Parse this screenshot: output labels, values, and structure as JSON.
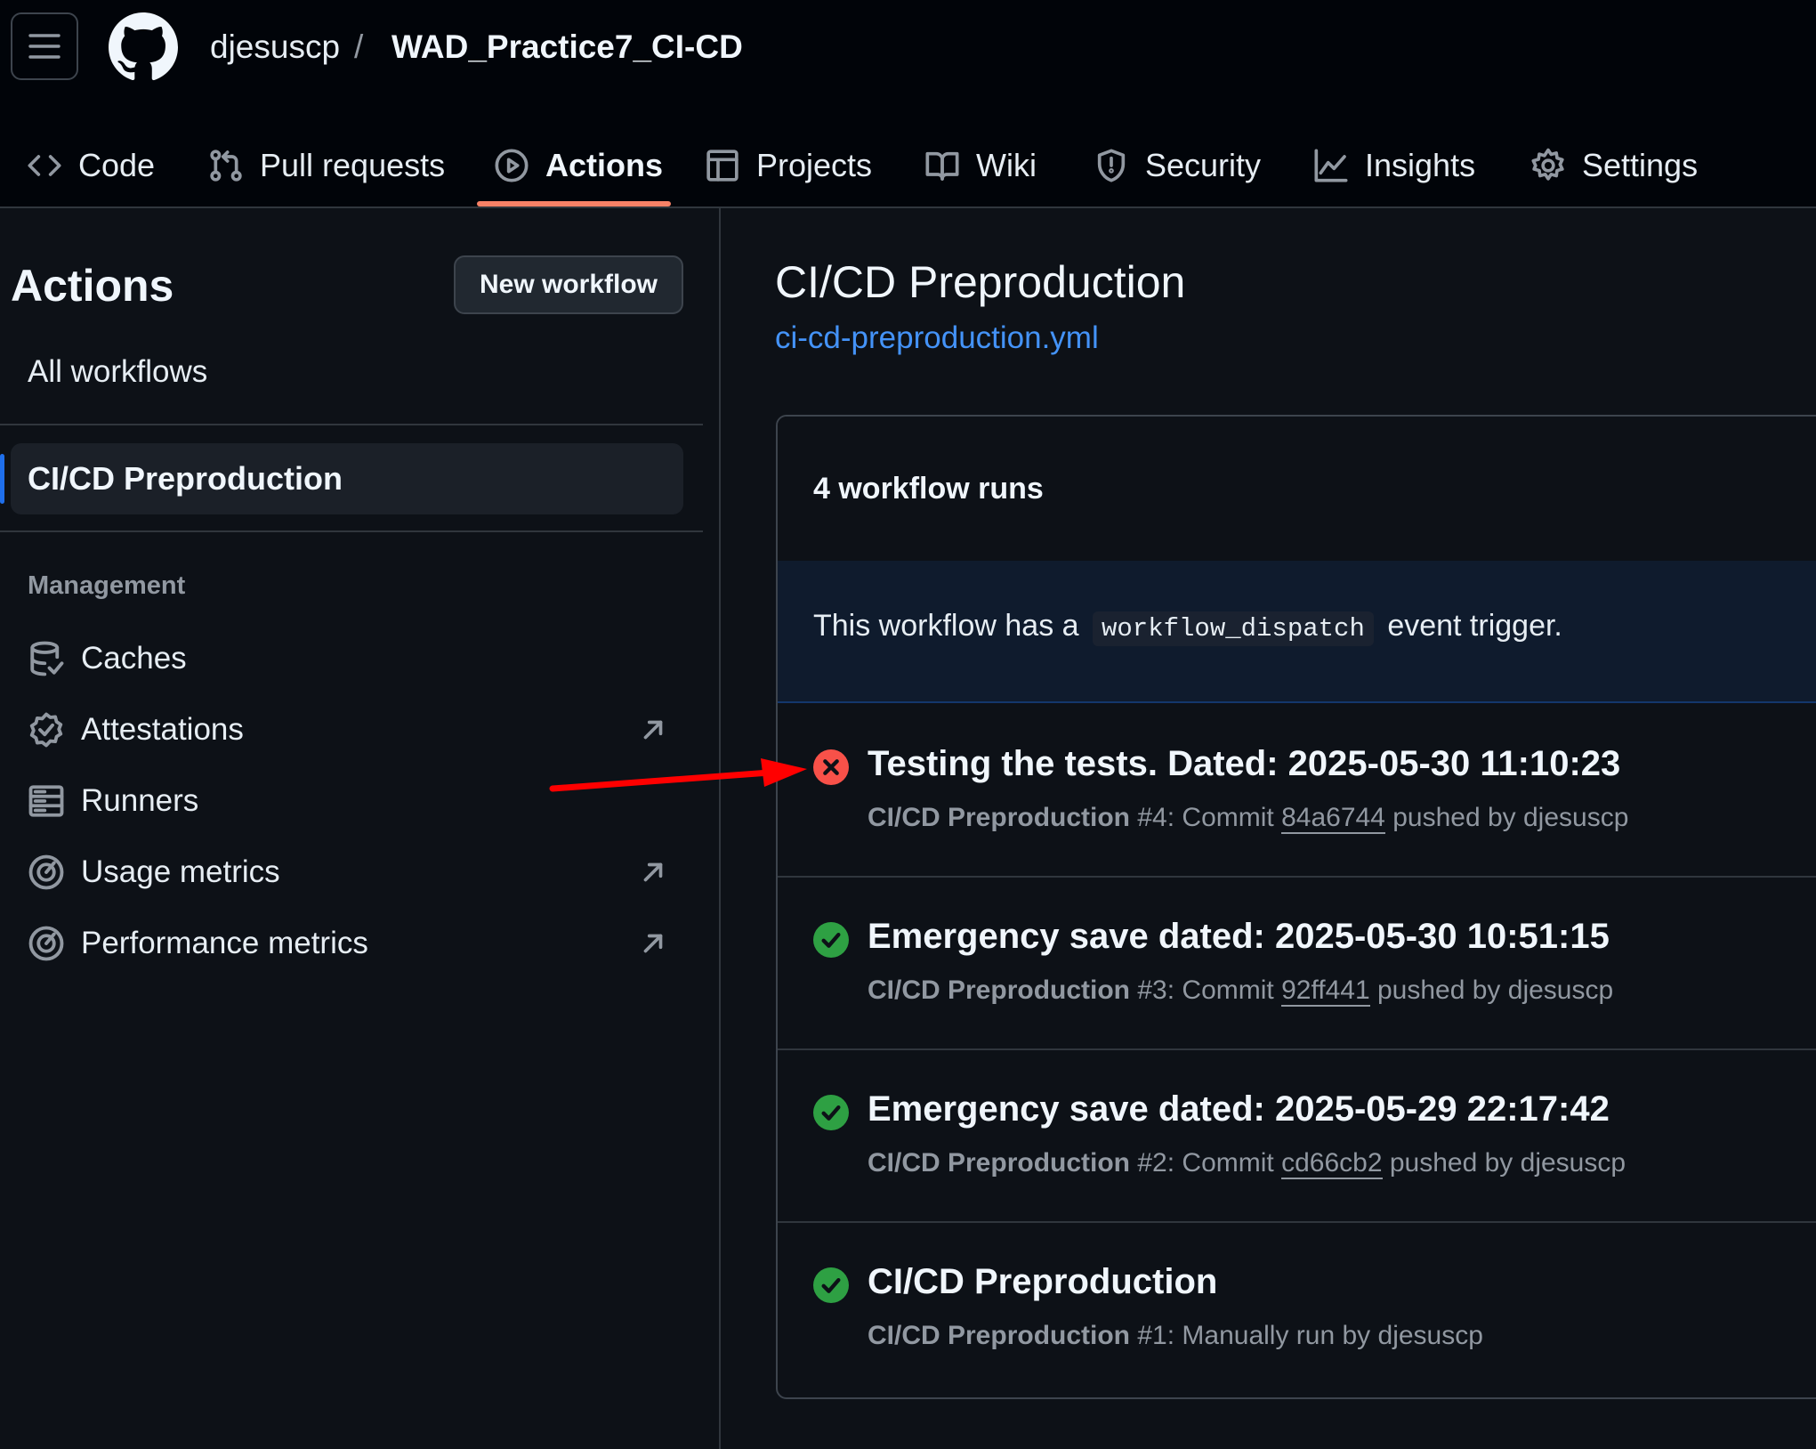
{
  "header": {
    "owner": "djesuscp",
    "separator": "/",
    "repo": "WAD_Practice7_CI-CD"
  },
  "tabs": [
    {
      "label": "Code",
      "icon": "code-icon"
    },
    {
      "label": "Pull requests",
      "icon": "git-pull-request-icon"
    },
    {
      "label": "Actions",
      "icon": "play-icon",
      "active": true
    },
    {
      "label": "Projects",
      "icon": "table-icon"
    },
    {
      "label": "Wiki",
      "icon": "book-icon"
    },
    {
      "label": "Security",
      "icon": "shield-icon"
    },
    {
      "label": "Insights",
      "icon": "graph-icon"
    },
    {
      "label": "Settings",
      "icon": "gear-icon"
    }
  ],
  "sidebar": {
    "title": "Actions",
    "new_workflow": "New workflow",
    "all_workflows": "All workflows",
    "active_workflow": "CI/CD Preproduction",
    "management_label": "Management",
    "management": [
      {
        "label": "Caches",
        "icon": "database-icon"
      },
      {
        "label": "Attestations",
        "icon": "verified-icon",
        "external": true
      },
      {
        "label": "Runners",
        "icon": "server-icon"
      },
      {
        "label": "Usage metrics",
        "icon": "meter-icon",
        "external": true
      },
      {
        "label": "Performance metrics",
        "icon": "meter-icon",
        "external": true
      }
    ]
  },
  "main": {
    "title": "CI/CD Preproduction",
    "file": "ci-cd-preproduction.yml",
    "runs_count": "4 workflow runs",
    "dispatch": {
      "before": "This workflow has a",
      "code": "workflow_dispatch",
      "after": "event trigger."
    },
    "runs": [
      {
        "status": "failure",
        "title": "Testing the tests. Dated: 2025-05-30 11:10:23",
        "workflow": "CI/CD Preproduction",
        "number": "#4: Commit",
        "sha": "84a6744",
        "suffix": "pushed by djesuscp"
      },
      {
        "status": "success",
        "title": "Emergency save dated: 2025-05-30 10:51:15",
        "workflow": "CI/CD Preproduction",
        "number": "#3: Commit",
        "sha": "92ff441",
        "suffix": "pushed by djesuscp"
      },
      {
        "status": "success",
        "title": "Emergency save dated: 2025-05-29 22:17:42",
        "workflow": "CI/CD Preproduction",
        "number": "#2: Commit",
        "sha": "cd66cb2",
        "suffix": "pushed by djesuscp"
      },
      {
        "status": "success",
        "title": "CI/CD Preproduction",
        "workflow": "CI/CD Preproduction",
        "number": "#1: Manually run by djesuscp",
        "sha": "",
        "suffix": ""
      }
    ]
  },
  "colors": {
    "failure": "#f85149",
    "success": "#2ea043",
    "link": "#4493f8",
    "tab_underline": "#f78166",
    "annotation_arrow": "#ff0000"
  }
}
